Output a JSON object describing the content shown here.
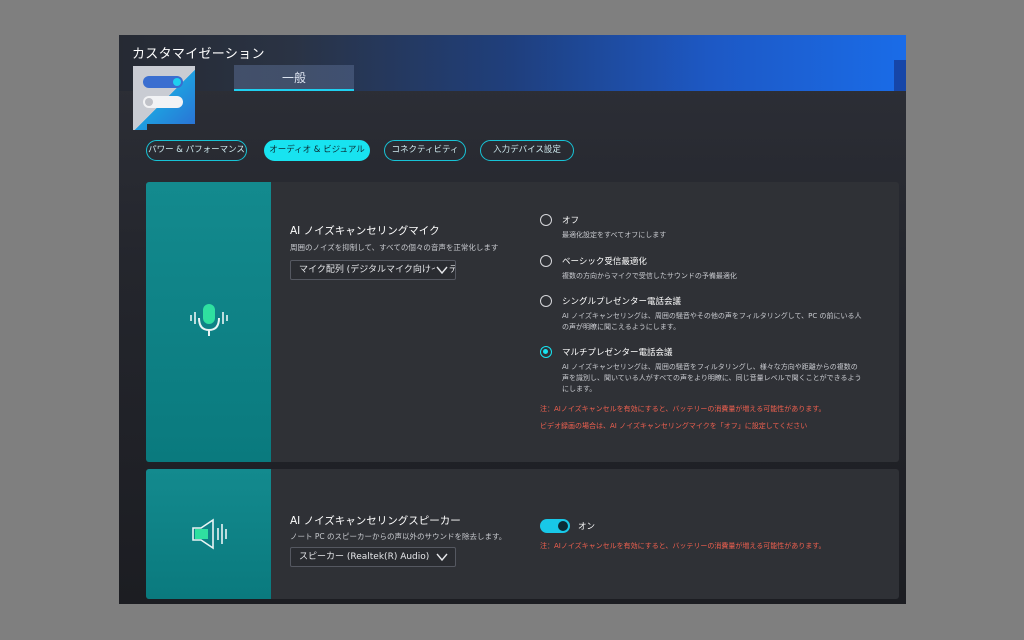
{
  "window": {
    "title": "カスタマイゼーション"
  },
  "main_tabs": [
    {
      "label": "一般"
    }
  ],
  "sub_tabs": [
    {
      "label": "パワー & パフォーマンス"
    },
    {
      "label": "オーディオ & ビジュアル"
    },
    {
      "label": "コネクティビティ"
    },
    {
      "label": "入力デバイス設定"
    }
  ],
  "mic_section": {
    "title": "AI ノイズキャンセリングマイク",
    "description": "周囲のノイズを抑制して、すべての個々の音声を正常化します",
    "dropdown_value": "マイク配列 (デジタルマイク向けインテル",
    "options": [
      {
        "label": "オフ",
        "desc": "最適化設定をすべてオフにします",
        "selected": false
      },
      {
        "label": "ベーシック受信最適化",
        "desc": "複数の方向からマイクで受信したサウンドの予備最適化",
        "selected": false
      },
      {
        "label": "シングルプレゼンター電話会議",
        "desc": "AI ノイズキャンセリングは、周囲の騒音やその他の声をフィルタリングして、PC の前にいる人の声が明瞭に聞こえるようにします。",
        "selected": false
      },
      {
        "label": "マルチプレゼンター電話会議",
        "desc": "AI ノイズキャンセリングは、周囲の騒音をフィルタリングし、様々な方向や距離からの複数の声を識別し、聞いている人がすべての声をより明瞭に、同じ音量レベルで聞くことができるようにします。",
        "selected": true
      }
    ],
    "warning1": "注：AIノイズキャンセルを有効にすると、バッテリーの消費量が増える可能性があります。",
    "warning2": "ビデオ録画の場合は、AI ノイズキャンセリングマイクを「オフ」に設定してください"
  },
  "speaker_section": {
    "title": "AI ノイズキャンセリングスピーカー",
    "description": "ノート PC のスピーカーからの声以外のサウンドを除去します。",
    "dropdown_value": "スピーカー (Realtek(R) Audio)",
    "toggle_label": "オン",
    "toggle_on": true,
    "warning": "注：AIノイズキャンセルを有効にすると、バッテリーの消費量が増える可能性があります。"
  },
  "colors": {
    "accent": "#18e3f0",
    "side_panel": "#0f8488",
    "warning": "#f0604f"
  }
}
